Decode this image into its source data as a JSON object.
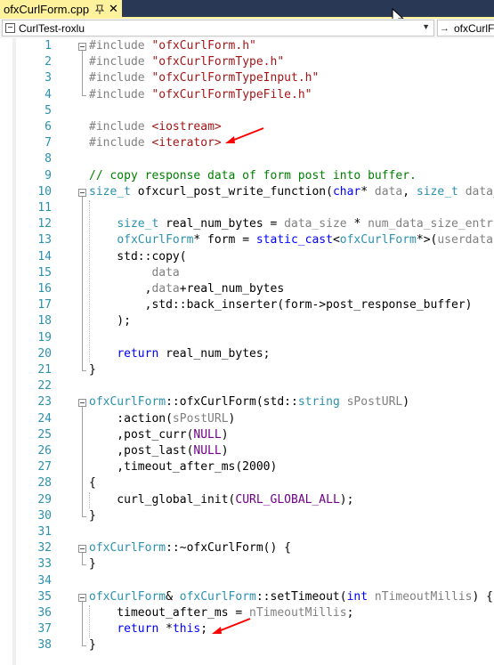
{
  "tab": {
    "title": "ofxCurlForm.cpp",
    "close": "✕"
  },
  "navbar": {
    "project": "CurlTest-roxlu",
    "scope": "ofxCurlForm",
    "dropdown": "▼",
    "scope_icon": "→"
  },
  "lines": [
    {
      "n": "1",
      "parts": [
        {
          "c": "p",
          "t": "#include "
        },
        {
          "c": "s",
          "t": "\"ofxCurlForm.h\""
        }
      ]
    },
    {
      "n": "2",
      "parts": [
        {
          "c": "p",
          "t": "#include "
        },
        {
          "c": "s",
          "t": "\"ofxCurlFormType.h\""
        }
      ]
    },
    {
      "n": "3",
      "parts": [
        {
          "c": "p",
          "t": "#include "
        },
        {
          "c": "s",
          "t": "\"ofxCurlFormTypeInput.h\""
        }
      ]
    },
    {
      "n": "4",
      "parts": [
        {
          "c": "p",
          "t": "#include "
        },
        {
          "c": "s",
          "t": "\"ofxCurlFormTypeFile.h\""
        }
      ]
    },
    {
      "n": "5",
      "parts": []
    },
    {
      "n": "6",
      "parts": [
        {
          "c": "p",
          "t": "#include "
        },
        {
          "c": "s",
          "t": "<iostream>"
        }
      ]
    },
    {
      "n": "7",
      "parts": [
        {
          "c": "p",
          "t": "#include "
        },
        {
          "c": "s",
          "t": "<iterator>"
        }
      ]
    },
    {
      "n": "8",
      "parts": []
    },
    {
      "n": "9",
      "parts": [
        {
          "c": "c",
          "t": "// copy response data of form post into buffer."
        }
      ]
    },
    {
      "n": "10",
      "parts": [
        {
          "c": "t",
          "t": "size_t"
        },
        {
          "c": "",
          "t": " ofxcurl_post_write_function("
        },
        {
          "c": "k",
          "t": "char"
        },
        {
          "c": "",
          "t": "* "
        },
        {
          "c": "g",
          "t": "data"
        },
        {
          "c": "",
          "t": ", "
        },
        {
          "c": "t",
          "t": "size_t"
        },
        {
          "c": "",
          "t": " "
        },
        {
          "c": "g",
          "t": "data_"
        }
      ]
    },
    {
      "n": "11",
      "parts": []
    },
    {
      "n": "12",
      "parts": [
        {
          "c": "",
          "t": "    "
        },
        {
          "c": "t",
          "t": "size_t"
        },
        {
          "c": "",
          "t": " real_num_bytes = "
        },
        {
          "c": "g",
          "t": "data_size"
        },
        {
          "c": "",
          "t": " * "
        },
        {
          "c": "g",
          "t": "num_data_size_entri"
        }
      ]
    },
    {
      "n": "13",
      "parts": [
        {
          "c": "",
          "t": "    "
        },
        {
          "c": "t",
          "t": "ofxCurlForm"
        },
        {
          "c": "",
          "t": "* form = "
        },
        {
          "c": "k",
          "t": "static_cast"
        },
        {
          "c": "",
          "t": "<"
        },
        {
          "c": "t",
          "t": "ofxCurlForm"
        },
        {
          "c": "",
          "t": "*>("
        },
        {
          "c": "g",
          "t": "userdata"
        },
        {
          "c": "",
          "t": ");"
        }
      ]
    },
    {
      "n": "14",
      "parts": [
        {
          "c": "",
          "t": "    std::copy("
        }
      ]
    },
    {
      "n": "15",
      "parts": [
        {
          "c": "",
          "t": "         "
        },
        {
          "c": "g",
          "t": "data"
        }
      ]
    },
    {
      "n": "16",
      "parts": [
        {
          "c": "",
          "t": "        ,"
        },
        {
          "c": "g",
          "t": "data"
        },
        {
          "c": "",
          "t": "+real_num_bytes"
        }
      ]
    },
    {
      "n": "17",
      "parts": [
        {
          "c": "",
          "t": "        ,std::back_inserter(form->post_response_buffer)"
        }
      ]
    },
    {
      "n": "18",
      "parts": [
        {
          "c": "",
          "t": "    );"
        }
      ]
    },
    {
      "n": "19",
      "parts": []
    },
    {
      "n": "20",
      "parts": [
        {
          "c": "",
          "t": "    "
        },
        {
          "c": "k",
          "t": "return"
        },
        {
          "c": "",
          "t": " real_num_bytes;"
        }
      ]
    },
    {
      "n": "21",
      "parts": [
        {
          "c": "",
          "t": "}"
        }
      ]
    },
    {
      "n": "22",
      "parts": []
    },
    {
      "n": "23",
      "parts": [
        {
          "c": "t",
          "t": "ofxCurlForm"
        },
        {
          "c": "",
          "t": "::ofxCurlForm(std::"
        },
        {
          "c": "t",
          "t": "string"
        },
        {
          "c": "",
          "t": " "
        },
        {
          "c": "g",
          "t": "sPostURL"
        },
        {
          "c": "",
          "t": ")"
        }
      ]
    },
    {
      "n": "24",
      "parts": [
        {
          "c": "",
          "t": "    :action("
        },
        {
          "c": "g",
          "t": "sPostURL"
        },
        {
          "c": "",
          "t": ")"
        }
      ]
    },
    {
      "n": "25",
      "parts": [
        {
          "c": "",
          "t": "    ,post_curr("
        },
        {
          "c": "m",
          "t": "NULL"
        },
        {
          "c": "",
          "t": ")"
        }
      ]
    },
    {
      "n": "26",
      "parts": [
        {
          "c": "",
          "t": "    ,post_last("
        },
        {
          "c": "m",
          "t": "NULL"
        },
        {
          "c": "",
          "t": ")"
        }
      ]
    },
    {
      "n": "27",
      "parts": [
        {
          "c": "",
          "t": "    ,timeout_after_ms(2000)"
        }
      ]
    },
    {
      "n": "28",
      "parts": [
        {
          "c": "",
          "t": "{"
        }
      ]
    },
    {
      "n": "29",
      "parts": [
        {
          "c": "",
          "t": "    curl_global_init("
        },
        {
          "c": "m",
          "t": "CURL_GLOBAL_ALL"
        },
        {
          "c": "",
          "t": ");"
        }
      ]
    },
    {
      "n": "30",
      "parts": [
        {
          "c": "",
          "t": "}"
        }
      ]
    },
    {
      "n": "31",
      "parts": []
    },
    {
      "n": "32",
      "parts": [
        {
          "c": "t",
          "t": "ofxCurlForm"
        },
        {
          "c": "",
          "t": "::~ofxCurlForm() {"
        }
      ]
    },
    {
      "n": "33",
      "parts": [
        {
          "c": "",
          "t": "}"
        }
      ]
    },
    {
      "n": "34",
      "parts": []
    },
    {
      "n": "35",
      "parts": [
        {
          "c": "t",
          "t": "ofxCurlForm"
        },
        {
          "c": "",
          "t": "& "
        },
        {
          "c": "t",
          "t": "ofxCurlForm"
        },
        {
          "c": "",
          "t": "::setTimeout("
        },
        {
          "c": "k",
          "t": "int"
        },
        {
          "c": "",
          "t": " "
        },
        {
          "c": "g",
          "t": "nTimeoutMillis"
        },
        {
          "c": "",
          "t": ") {"
        }
      ]
    },
    {
      "n": "36",
      "parts": [
        {
          "c": "",
          "t": "    timeout_after_ms = "
        },
        {
          "c": "g",
          "t": "nTimeoutMillis"
        },
        {
          "c": "",
          "t": ";"
        }
      ]
    },
    {
      "n": "37",
      "parts": [
        {
          "c": "",
          "t": "    "
        },
        {
          "c": "k",
          "t": "return"
        },
        {
          "c": "",
          "t": " *"
        },
        {
          "c": "k",
          "t": "this"
        },
        {
          "c": "",
          "t": ";"
        }
      ]
    },
    {
      "n": "38",
      "parts": [
        {
          "c": "",
          "t": "}"
        }
      ]
    }
  ],
  "colors": {
    "tab_bg": "#fff29d",
    "tabstrip_bg": "#293955",
    "line_number": "#2b91af",
    "keyword": "#0000ff",
    "type": "#2b91af",
    "string": "#a31515",
    "comment": "#008000",
    "macro": "#6f008a",
    "arrow": "#ff0000"
  },
  "annotations": [
    "arrow-icon",
    "arrow-icon"
  ]
}
